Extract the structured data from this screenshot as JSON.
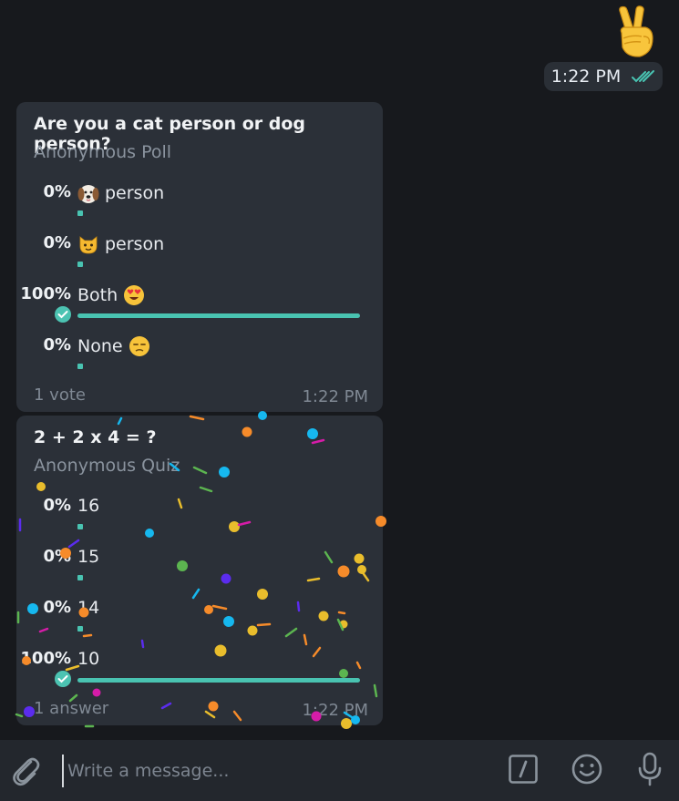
{
  "outgoing": {
    "emoji_name": "victory-hand-emoji",
    "time": "1:22 PM",
    "status_icon": "double-check-icon"
  },
  "poll": {
    "question": "Are you a cat person or dog person?",
    "type_label": "Anonymous Poll",
    "options": [
      {
        "percent": "0%",
        "emoji": "dog-face-emoji",
        "text": "person",
        "fraction": 0,
        "chosen": false
      },
      {
        "percent": "0%",
        "emoji": "cat-face-emoji",
        "text": "person",
        "fraction": 0,
        "chosen": false
      },
      {
        "percent": "100%",
        "text": "Both",
        "emoji_after": "heart-eyes-emoji",
        "fraction": 1,
        "chosen": true
      },
      {
        "percent": "0%",
        "text": "None",
        "emoji_after": "unamused-face-emoji",
        "fraction": 0,
        "chosen": false
      }
    ],
    "votes": "1 vote",
    "time": "1:22 PM"
  },
  "quiz": {
    "question": "2 + 2 x 4 = ?",
    "type_label": "Anonymous Quiz",
    "options": [
      {
        "percent": "0%",
        "text": "16",
        "fraction": 0,
        "chosen": false
      },
      {
        "percent": "0%",
        "text": "15",
        "fraction": 0,
        "chosen": false
      },
      {
        "percent": "0%",
        "text": "14",
        "fraction": 0,
        "chosen": false
      },
      {
        "percent": "100%",
        "text": "10",
        "fraction": 1,
        "chosen": true
      }
    ],
    "answers": "1 answer",
    "time": "1:22 PM"
  },
  "composer": {
    "placeholder": "Write a message...",
    "attach_icon": "paperclip-icon",
    "commands_icon": "slash-command-icon",
    "emoji_icon": "smiley-icon",
    "mic_icon": "microphone-icon"
  },
  "colors": {
    "background": "#17191d",
    "bubble": "#2b3038",
    "accent": "#49c3b1",
    "composer": "#23272d"
  }
}
